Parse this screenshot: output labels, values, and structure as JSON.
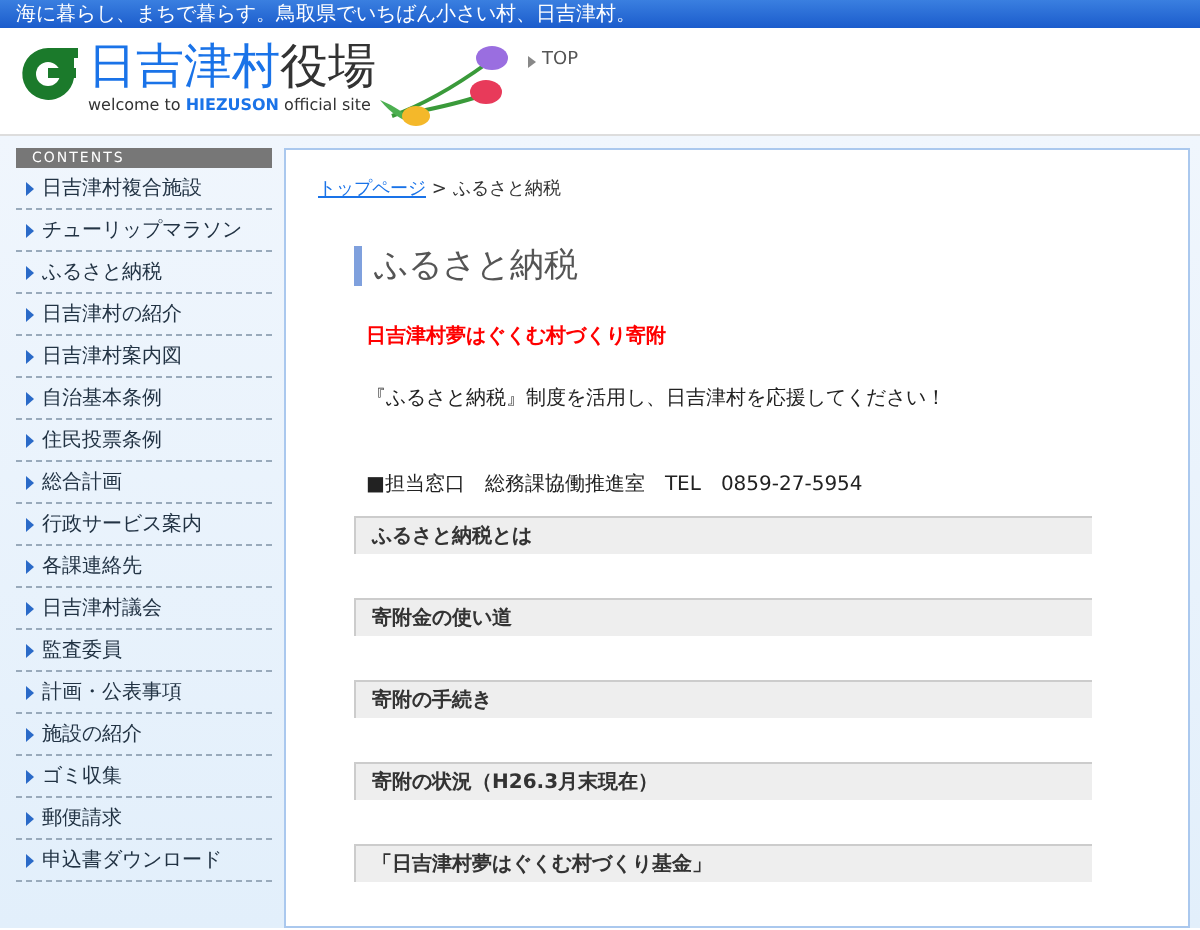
{
  "top_bar": {
    "tagline": "海に暮らし、まちで暮らす。鳥取県でいちばん小さい村、日吉津村。"
  },
  "header": {
    "logo_title_blue": "日吉津村",
    "logo_title_dark": "役場",
    "logo_subtitle_before": "welcome to ",
    "logo_subtitle_brand": "HIEZUSON",
    "logo_subtitle_after": " official site",
    "top_link": "TOP"
  },
  "sidebar": {
    "heading": "CONTENTS",
    "items": [
      {
        "label": "日吉津村複合施設"
      },
      {
        "label": "チューリップマラソン"
      },
      {
        "label": "ふるさと納税"
      },
      {
        "label": "日吉津村の紹介"
      },
      {
        "label": "日吉津村案内図"
      },
      {
        "label": "自治基本条例"
      },
      {
        "label": "住民投票条例"
      },
      {
        "label": "総合計画"
      },
      {
        "label": "行政サービス案内"
      },
      {
        "label": "各課連絡先"
      },
      {
        "label": "日吉津村議会"
      },
      {
        "label": "監査委員"
      },
      {
        "label": "計画・公表事項"
      },
      {
        "label": "施設の紹介"
      },
      {
        "label": "ゴミ収集"
      },
      {
        "label": "郵便請求"
      },
      {
        "label": "申込書ダウンロード"
      }
    ]
  },
  "breadcrumb": {
    "link": "トップページ",
    "separator": ">",
    "current": "ふるさと納税"
  },
  "page_title": "ふるさと納税",
  "highlight": "日吉津村夢はぐくむ村づくり寄附",
  "intro": "『ふるさと納税』制度を活用し、日吉津村を応援してください！",
  "contact": "■担当窓口　総務課協働推進室　TEL　0859-27-5954",
  "sections": [
    "ふるさと納税とは",
    "寄附金の使い道",
    "寄附の手続き",
    "寄附の状況（H26.3月末現在）",
    "「日吉津村夢はぐくむ村づくり基金」"
  ]
}
